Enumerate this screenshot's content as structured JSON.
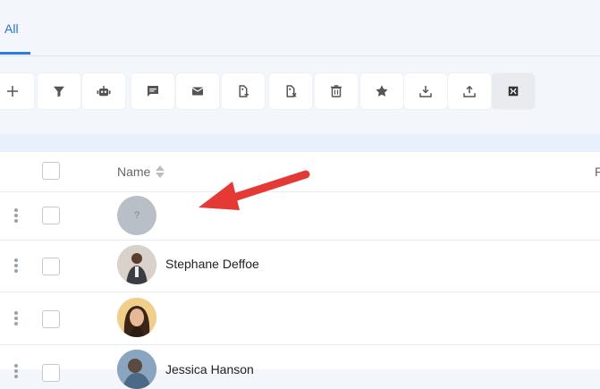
{
  "tabs": {
    "all_label": "All"
  },
  "toolbar": {
    "buttons": [
      {
        "icon": "plus-icon"
      },
      {
        "icon": "filter-icon"
      },
      {
        "icon": "robot-icon"
      },
      {
        "icon": "chat-icon"
      },
      {
        "icon": "mail-icon"
      },
      {
        "icon": "tag-add-icon"
      },
      {
        "icon": "tag-remove-icon"
      },
      {
        "icon": "trash-icon"
      },
      {
        "icon": "star-icon"
      },
      {
        "icon": "download-icon"
      },
      {
        "icon": "upload-icon"
      },
      {
        "icon": "merge-icon"
      }
    ]
  },
  "table": {
    "name_header": "Name",
    "rows": [
      {
        "name": "",
        "avatar": "placeholder",
        "placeholder_glyph": "?"
      },
      {
        "name": "Stephane Deffoe",
        "avatar": "photo"
      },
      {
        "name": "",
        "avatar": "photo"
      },
      {
        "name": "Jessica Hanson",
        "avatar": "photo"
      }
    ]
  },
  "colors": {
    "accent": "#2b7de0",
    "arrow": "#e53935"
  }
}
